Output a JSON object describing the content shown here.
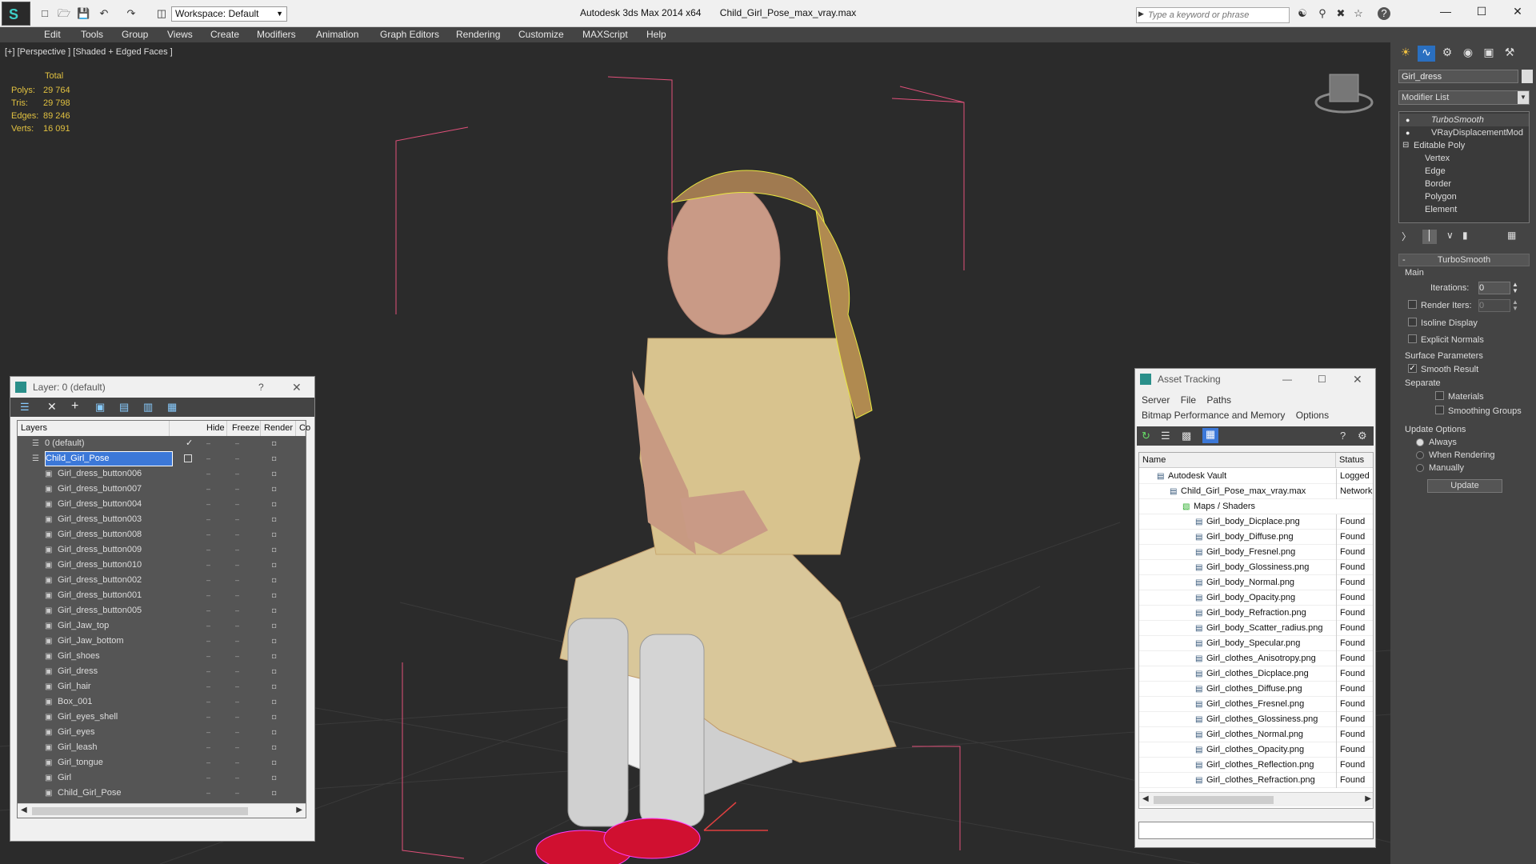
{
  "title": {
    "app": "Autodesk 3ds Max  2014 x64",
    "file": "Child_Girl_Pose_max_vray.max"
  },
  "workspace": "Workspace: Default",
  "search_placeholder": "Type a keyword or phrase",
  "menu": [
    "Edit",
    "Tools",
    "Group",
    "Views",
    "Create",
    "Modifiers",
    "Animation",
    "Graph Editors",
    "Rendering",
    "Customize",
    "MAXScript",
    "Help"
  ],
  "viewport": {
    "label": "[+] [Perspective ] [Shaded + Edged Faces ]",
    "stats": {
      "header": "Total",
      "rows": [
        [
          "Polys:",
          "29 764"
        ],
        [
          "Tris:",
          "29 798"
        ],
        [
          "Edges:",
          "89 246"
        ],
        [
          "Verts:",
          "16 091"
        ]
      ]
    }
  },
  "command_panel": {
    "object_name": "Girl_dress",
    "modifier_list": "Modifier List",
    "stack": [
      "TurboSmooth",
      "VRayDisplacementMod",
      "Editable Poly",
      "Vertex",
      "Edge",
      "Border",
      "Polygon",
      "Element"
    ],
    "rollout_title": "TurboSmooth",
    "main_label": "Main",
    "iterations_label": "Iterations:",
    "iterations_value": "0",
    "render_iters_label": "Render Iters:",
    "render_iters_value": "0",
    "isoline": "Isoline Display",
    "explicit_normals": "Explicit Normals",
    "surface_params": "Surface Parameters",
    "smooth_result": "Smooth Result",
    "separate": "Separate",
    "materials": "Materials",
    "smoothing_groups": "Smoothing Groups",
    "update_options": "Update Options",
    "always": "Always",
    "when_rendering": "When Rendering",
    "manually": "Manually",
    "update_button": "Update"
  },
  "layer_dialog": {
    "title": "Layer: 0 (default)",
    "help": "?",
    "columns": [
      "Layers",
      "Hide",
      "Freeze",
      "Render",
      "Co"
    ],
    "rows": [
      {
        "name": "0 (default)",
        "level": 1
      },
      {
        "name": "Child_Girl_Pose",
        "level": 1,
        "selected": true
      },
      {
        "name": "Girl_dress_button006",
        "level": 2
      },
      {
        "name": "Girl_dress_button007",
        "level": 2
      },
      {
        "name": "Girl_dress_button004",
        "level": 2
      },
      {
        "name": "Girl_dress_button003",
        "level": 2
      },
      {
        "name": "Girl_dress_button008",
        "level": 2
      },
      {
        "name": "Girl_dress_button009",
        "level": 2
      },
      {
        "name": "Girl_dress_button010",
        "level": 2
      },
      {
        "name": "Girl_dress_button002",
        "level": 2
      },
      {
        "name": "Girl_dress_button001",
        "level": 2
      },
      {
        "name": "Girl_dress_button005",
        "level": 2
      },
      {
        "name": "Girl_Jaw_top",
        "level": 2
      },
      {
        "name": "Girl_Jaw_bottom",
        "level": 2
      },
      {
        "name": "Girl_shoes",
        "level": 2
      },
      {
        "name": "Girl_dress",
        "level": 2
      },
      {
        "name": "Girl_hair",
        "level": 2
      },
      {
        "name": "Box_001",
        "level": 2
      },
      {
        "name": "Girl_eyes_shell",
        "level": 2
      },
      {
        "name": "Girl_eyes",
        "level": 2
      },
      {
        "name": "Girl_leash",
        "level": 2
      },
      {
        "name": "Girl_tongue",
        "level": 2
      },
      {
        "name": "Girl",
        "level": 2
      },
      {
        "name": "Child_Girl_Pose",
        "level": 2
      }
    ]
  },
  "asset_tracking": {
    "title": "Asset Tracking",
    "menu": [
      "Server",
      "File",
      "Paths"
    ],
    "menu2": [
      "Bitmap Performance and Memory",
      "Options"
    ],
    "columns": [
      "Name",
      "Status"
    ],
    "rows": [
      {
        "name": "Autodesk Vault",
        "status": "Logged",
        "level": 1
      },
      {
        "name": "Child_Girl_Pose_max_vray.max",
        "status": "Network",
        "level": 2
      },
      {
        "name": "Maps / Shaders",
        "status": "",
        "level": 3
      },
      {
        "name": "Girl_body_Dicplace.png",
        "status": "Found",
        "level": 4
      },
      {
        "name": "Girl_body_Diffuse.png",
        "status": "Found",
        "level": 4
      },
      {
        "name": "Girl_body_Fresnel.png",
        "status": "Found",
        "level": 4
      },
      {
        "name": "Girl_body_Glossiness.png",
        "status": "Found",
        "level": 4
      },
      {
        "name": "Girl_body_Normal.png",
        "status": "Found",
        "level": 4
      },
      {
        "name": "Girl_body_Opacity.png",
        "status": "Found",
        "level": 4
      },
      {
        "name": "Girl_body_Refraction.png",
        "status": "Found",
        "level": 4
      },
      {
        "name": "Girl_body_Scatter_radius.png",
        "status": "Found",
        "level": 4
      },
      {
        "name": "Girl_body_Specular.png",
        "status": "Found",
        "level": 4
      },
      {
        "name": "Girl_clothes_Anisotropy.png",
        "status": "Found",
        "level": 4
      },
      {
        "name": "Girl_clothes_Dicplace.png",
        "status": "Found",
        "level": 4
      },
      {
        "name": "Girl_clothes_Diffuse.png",
        "status": "Found",
        "level": 4
      },
      {
        "name": "Girl_clothes_Fresnel.png",
        "status": "Found",
        "level": 4
      },
      {
        "name": "Girl_clothes_Glossiness.png",
        "status": "Found",
        "level": 4
      },
      {
        "name": "Girl_clothes_Normal.png",
        "status": "Found",
        "level": 4
      },
      {
        "name": "Girl_clothes_Opacity.png",
        "status": "Found",
        "level": 4
      },
      {
        "name": "Girl_clothes_Reflection.png",
        "status": "Found",
        "level": 4
      },
      {
        "name": "Girl_clothes_Refraction.png",
        "status": "Found",
        "level": 4
      }
    ]
  },
  "colors": {
    "accent": "#3399ff",
    "selected_row": "#3c78d8",
    "viewport_bg": "#2b2b2b",
    "stats_text": "#e0c040"
  }
}
